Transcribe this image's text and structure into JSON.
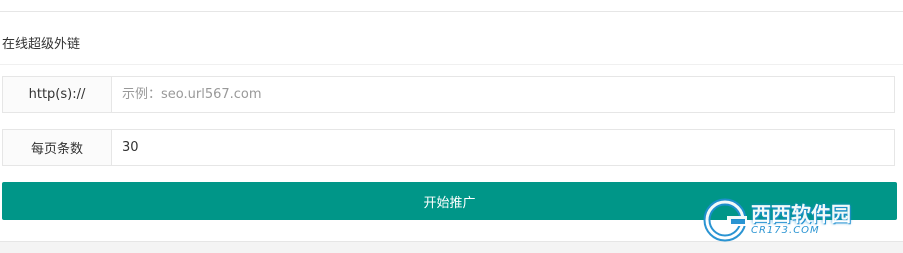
{
  "panel": {
    "title": "在线超级外链"
  },
  "form": {
    "url_row": {
      "label": "http(s)://",
      "value": "",
      "placeholder": "示例：seo.url567.com"
    },
    "per_page_row": {
      "label": "每页条数",
      "value": "30"
    },
    "submit_label": "开始推广"
  },
  "watermark": {
    "name": "西西软件园",
    "domain": "CR173.COM"
  },
  "colors": {
    "primary_button": "#009688",
    "border": "#e6e6e6",
    "label_bg": "#fbfbfb",
    "watermark_blue": "#1f8fd0"
  }
}
